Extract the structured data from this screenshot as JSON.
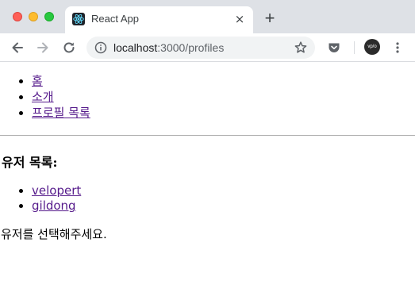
{
  "browser": {
    "tab": {
      "title": "React App",
      "favicon": "react-logo-icon",
      "close": "×"
    },
    "new_tab": "+",
    "address": {
      "host": "localhost",
      "path": ":3000/profiles"
    },
    "profile": "vp/o",
    "colors": {
      "titlebar": "#dee1e6",
      "link": "#551a8b"
    }
  },
  "nav": {
    "items": [
      {
        "label": "홈"
      },
      {
        "label": "소개"
      },
      {
        "label": "프로필 목록"
      }
    ]
  },
  "profiles": {
    "title": "유저 목록:",
    "users": [
      {
        "label": "velopert"
      },
      {
        "label": "gildong"
      }
    ],
    "prompt": "유저를 선택해주세요."
  }
}
